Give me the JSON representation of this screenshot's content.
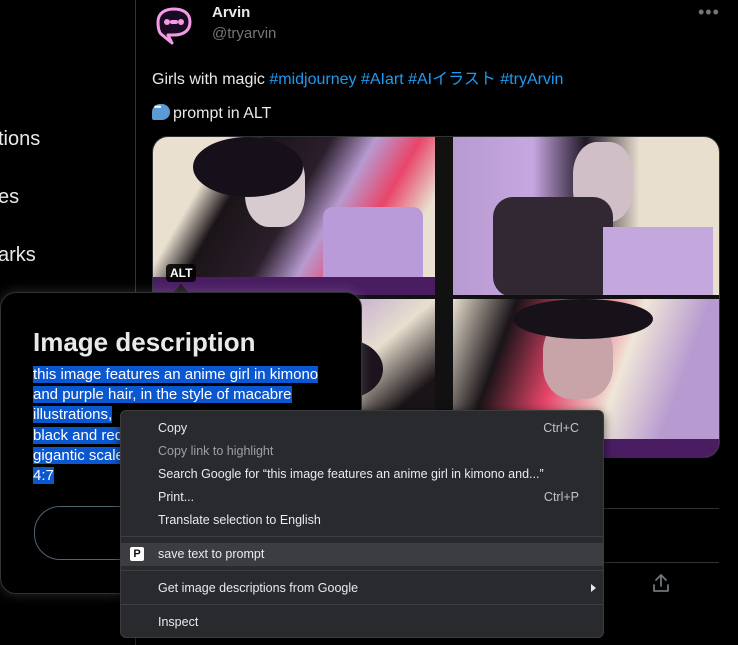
{
  "sidebar": {
    "fragments": [
      "tions",
      "es",
      "arks"
    ]
  },
  "tweet": {
    "author_name": "Arvin",
    "author_handle": "@tryarvin",
    "more_label": "•••",
    "text_plain": "Girls with magic ",
    "hashtags": [
      "#midjourney",
      "#AIart",
      "#AIイラスト",
      "#tryArvin"
    ],
    "prompt_line": "prompt in ALT",
    "alt_badge": "ALT"
  },
  "alt_popover": {
    "title": "Image description",
    "description": "this image features an anime girl in kimono and purple hair, in the style of macabre illustrations, dark sorcery, sharp sitting light black and red, gigantic scale, 4:7",
    "visible_lines": [
      "this image features an anime girl in kimono",
      "and purple hair, in the style of macabre",
      "illustrations,",
      "black and red",
      "gigantic scale",
      "4:7"
    ]
  },
  "context_menu": {
    "items": [
      {
        "label": "Copy",
        "shortcut": "Ctrl+C",
        "disabled": false
      },
      {
        "label": "Copy link to highlight",
        "shortcut": "",
        "disabled": true
      },
      {
        "label": "Search Google for “this image features an anime girl in kimono and...”",
        "shortcut": "",
        "disabled": false
      },
      {
        "label": "Print...",
        "shortcut": "Ctrl+P",
        "disabled": false
      },
      {
        "label": "Translate selection to English",
        "shortcut": "",
        "disabled": false
      },
      {
        "label": "save text to prompt",
        "shortcut": "",
        "disabled": false,
        "icon": "P"
      },
      {
        "label": "Get image descriptions from Google",
        "shortcut": "",
        "disabled": false,
        "submenu": true
      },
      {
        "label": "Inspect",
        "shortcut": "",
        "disabled": false
      }
    ]
  },
  "colors": {
    "background": "#000000",
    "accent": "#1d9bf0",
    "selection": "#0b57d0",
    "menu_bg": "#292a2d"
  },
  "icons": [
    "avatar-chat-icon",
    "more-icon",
    "speech-bubble-icon",
    "share-icon",
    "submenu-chevron-icon",
    "prompt-p-icon"
  ]
}
